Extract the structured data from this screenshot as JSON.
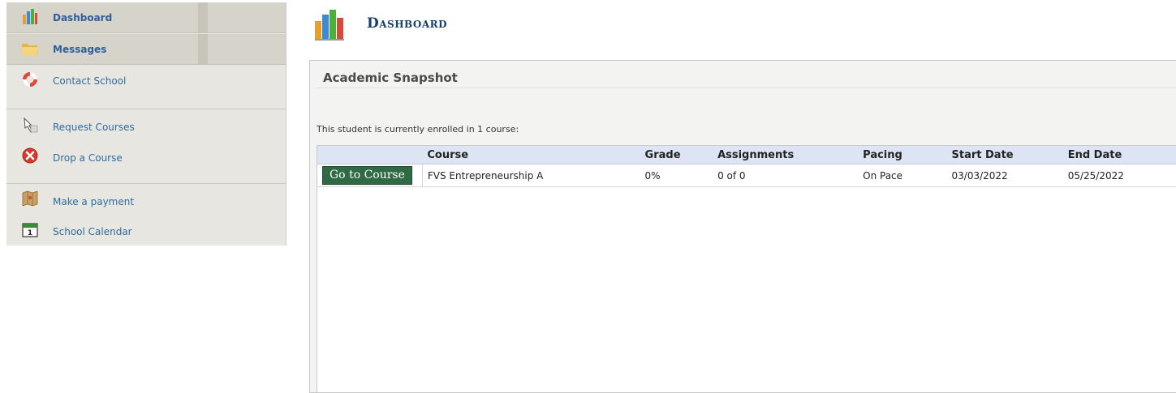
{
  "sidebar": {
    "items": [
      {
        "label": "Dashboard",
        "icon": "bar-chart-icon"
      },
      {
        "label": "Messages",
        "icon": "folder-icon"
      },
      {
        "label": "Contact School",
        "icon": "lifebuoy-icon"
      },
      {
        "label": "Request Courses",
        "icon": "pointer-hand-icon"
      },
      {
        "label": "Drop a Course",
        "icon": "red-x-icon"
      },
      {
        "label": "Make a payment",
        "icon": "map-icon"
      },
      {
        "label": "School Calendar",
        "icon": "calendar-icon"
      }
    ]
  },
  "header": {
    "title": "Dashboard",
    "icon": "bar-chart-icon"
  },
  "panel": {
    "title": "Academic Snapshot",
    "enrollment_text": "This student is currently enrolled in 1 course:"
  },
  "table": {
    "columns": [
      "Course",
      "Grade",
      "Assignments",
      "Pacing",
      "Start Date",
      "End Date"
    ],
    "rows": [
      {
        "button_label": "Go to Course",
        "course": "FVS Entrepreneurship A",
        "grade": "0%",
        "assignments": "0 of 0",
        "pacing": "On Pace",
        "start_date": "03/03/2022",
        "end_date": "05/25/2022"
      }
    ]
  },
  "colors": {
    "nav_link": "#2e6da4",
    "title": "#16406e",
    "button": "#2f6a45",
    "table_header": "#dde4f4"
  }
}
